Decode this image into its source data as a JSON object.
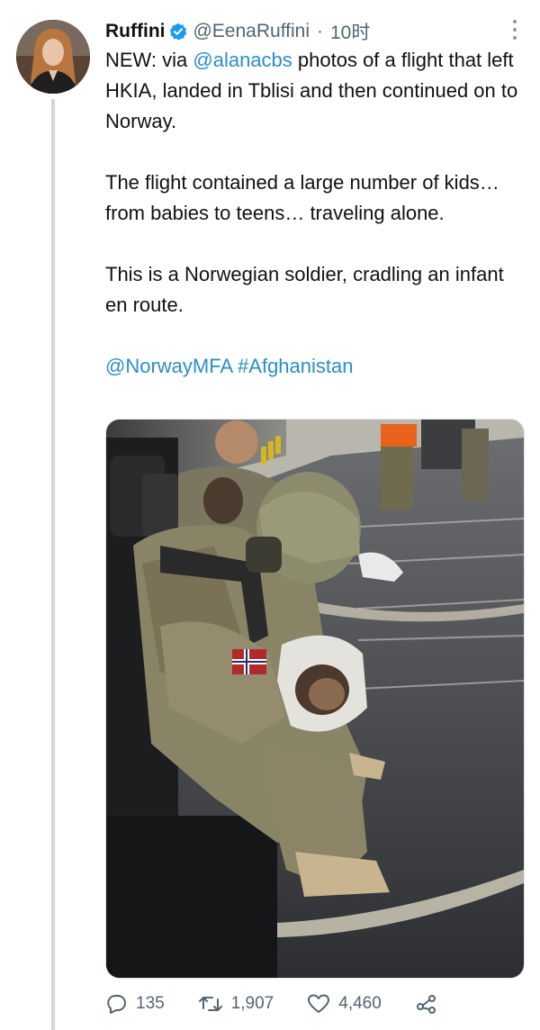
{
  "tweet": {
    "display_name": "Ruffini",
    "handle": "@EenaRuffini",
    "separator": "·",
    "time": "10时",
    "text_line1_prefix": "NEW: via ",
    "mention_alana": "@alanacbs",
    "text_line1_suffix": " photos of a flight that left HKIA, landed in Tblisi and then continued on to Norway.",
    "paragraph2": "The flight contained a large number of kids… from babies to teens… traveling alone.",
    "paragraph3": "This is a Norwegian soldier, cradling an infant en route.",
    "mention_mfa": "@NorwayMFA",
    "hashtag": "#Afghanistan"
  },
  "actions": {
    "replies": "135",
    "retweets": "1,907",
    "likes": "4,460"
  },
  "icons": [
    "verified-badge-icon",
    "more-options-icon",
    "reply-icon",
    "retweet-icon",
    "like-icon",
    "share-icon"
  ],
  "colors": {
    "link": "#2a8ec9",
    "verified": "#1d9bf0",
    "muted": "#536471",
    "thread_line": "#cfd9de"
  }
}
